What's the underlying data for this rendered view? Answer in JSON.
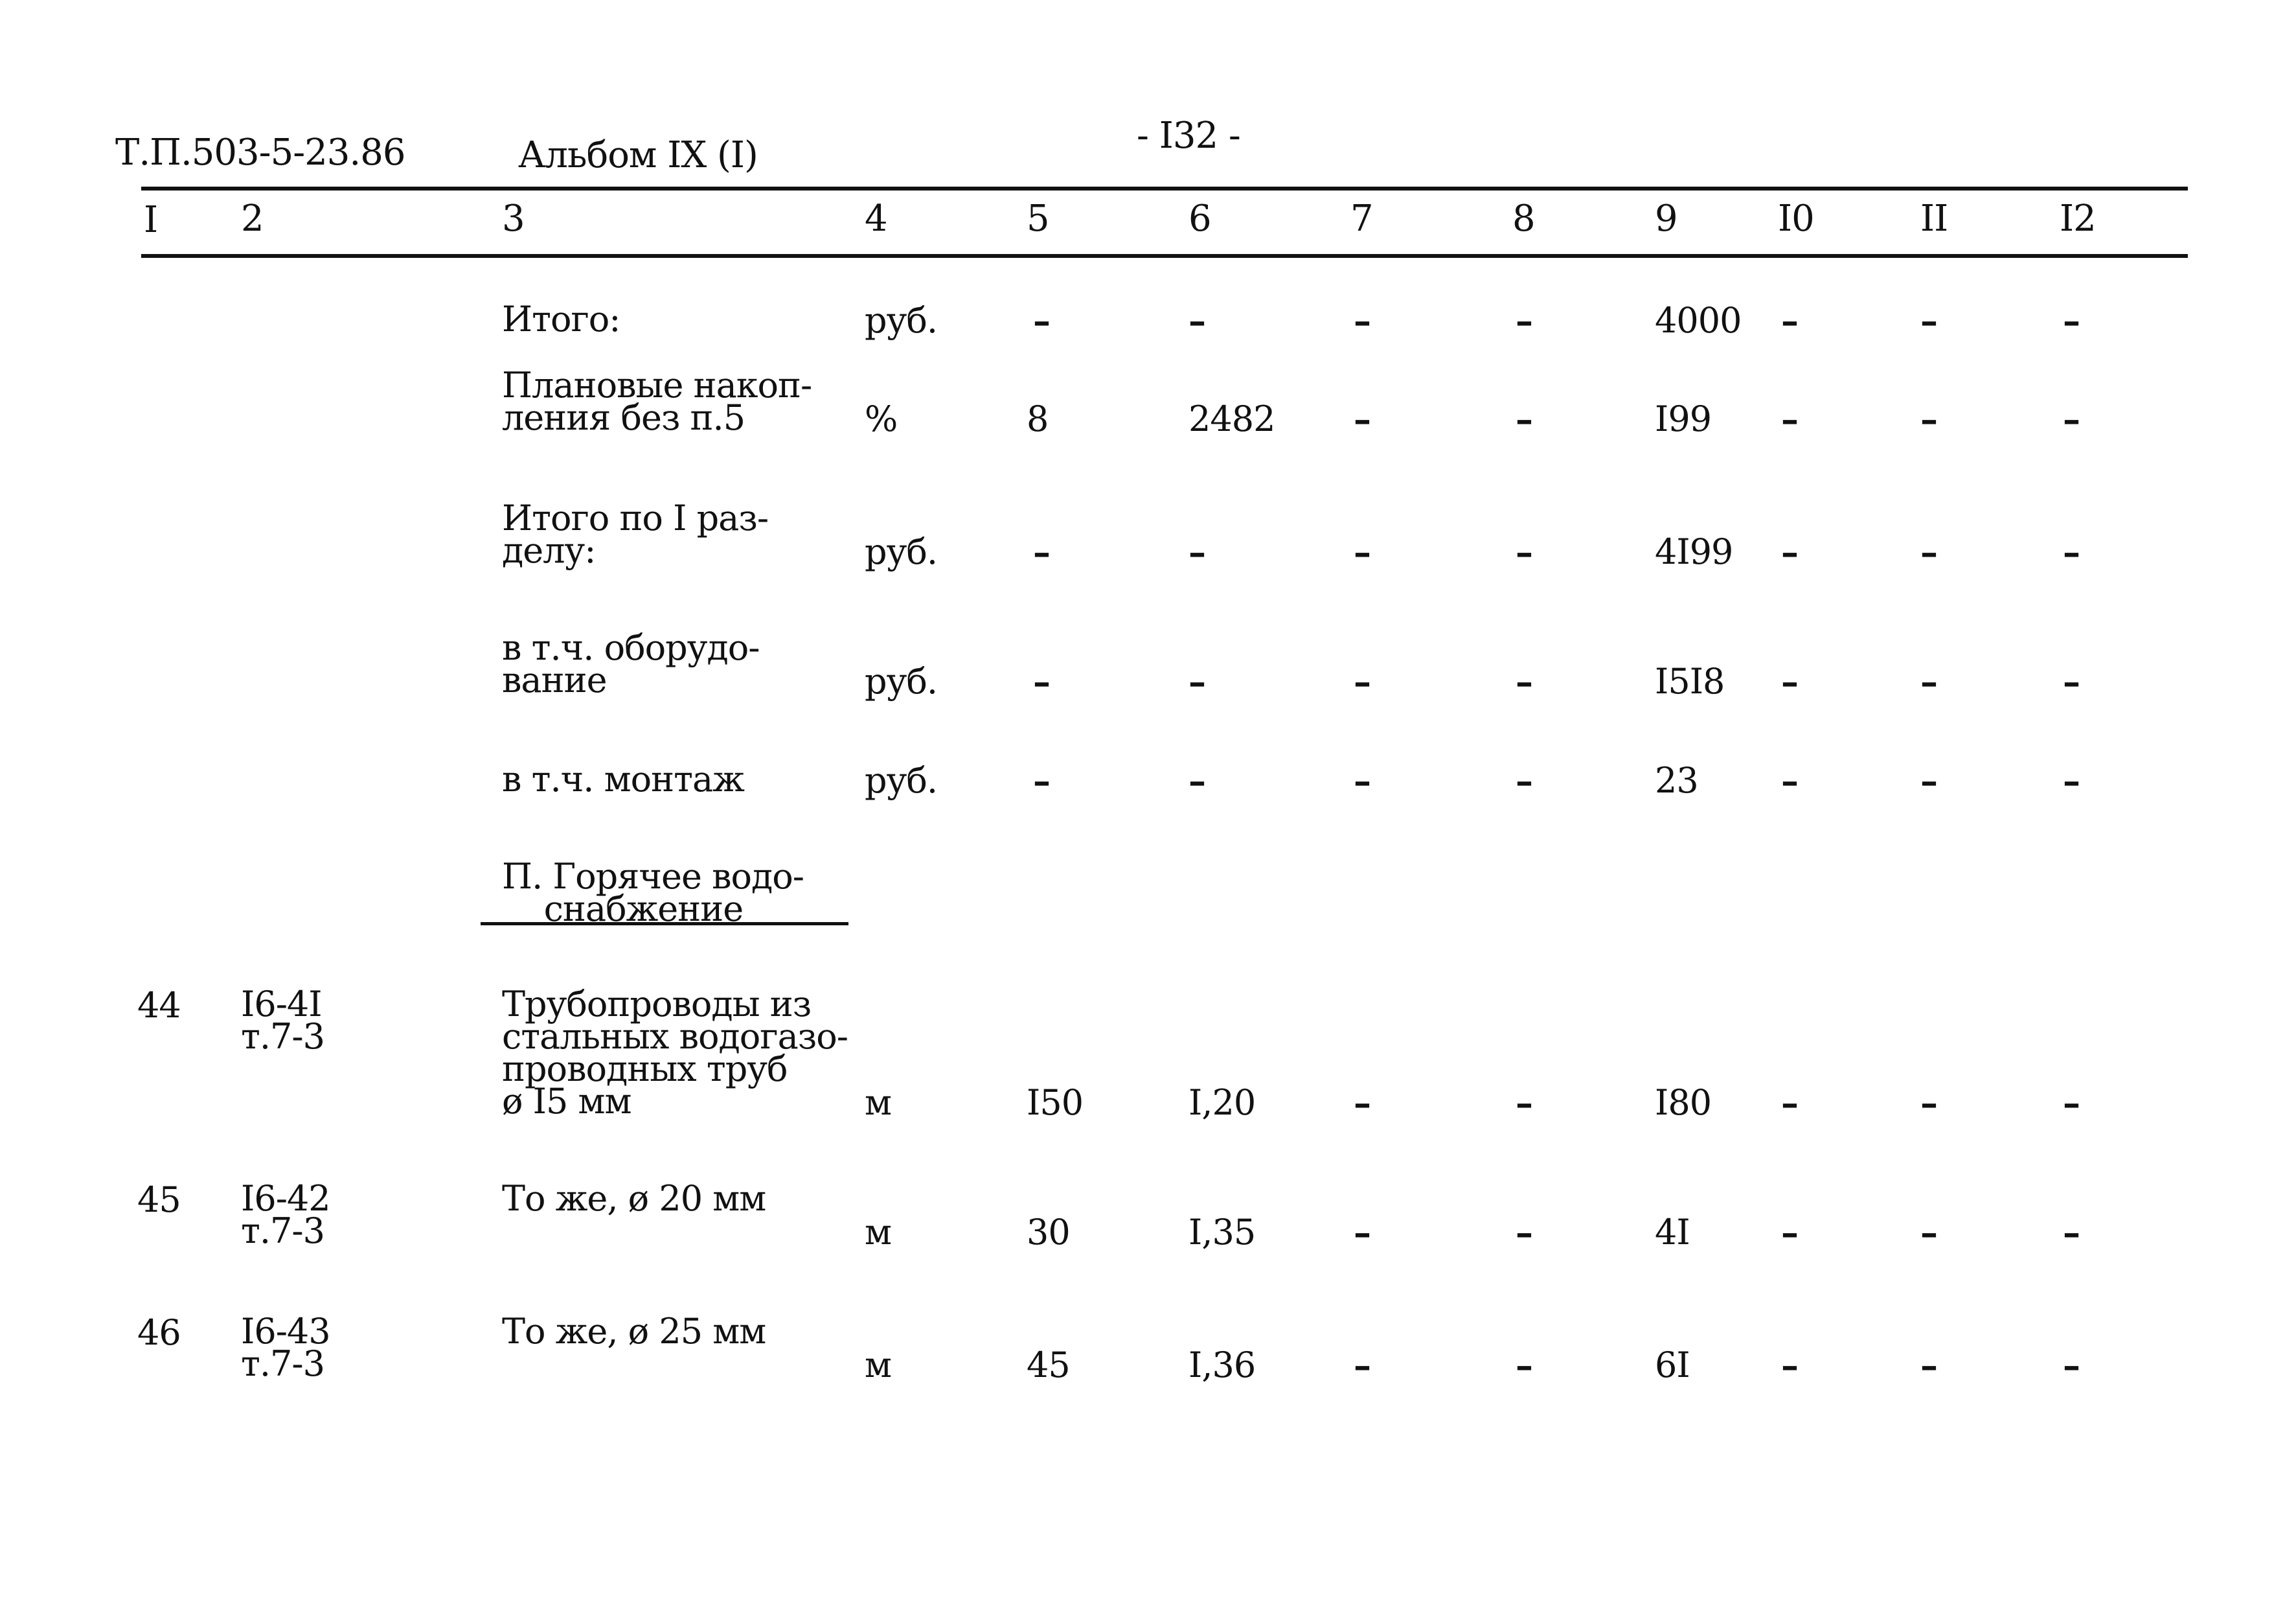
{
  "header": {
    "doc_code": "Т.П.503-5-23.86",
    "album": "Альбом IX (I)",
    "page_number": "- I32 -"
  },
  "columns": [
    "I",
    "2",
    "3",
    "4",
    "5",
    "6",
    "7",
    "8",
    "9",
    "I0",
    "II",
    "I2"
  ],
  "summary_rows": [
    {
      "name": "Итого:",
      "unit": "руб.",
      "c5": "–",
      "c6": "–",
      "c7": "–",
      "c8": "–",
      "c9": "4000",
      "c10": "–",
      "c11": "–",
      "c12": "–"
    },
    {
      "name": "Плановые накоп-\nления без п.5",
      "unit": "%",
      "c5": "8",
      "c6": "2482",
      "c7": "–",
      "c8": "–",
      "c9": "I99",
      "c10": "–",
      "c11": "–",
      "c12": "–"
    },
    {
      "name": "Итого по I раз-\nделу:",
      "unit": "руб.",
      "c5": "–",
      "c6": "–",
      "c7": "–",
      "c8": "–",
      "c9": "4I99",
      "c10": "–",
      "c11": "–",
      "c12": "–"
    },
    {
      "name": "в т.ч. оборудо-\nвание",
      "unit": "руб.",
      "c5": "–",
      "c6": "–",
      "c7": "–",
      "c8": "–",
      "c9": "I5I8",
      "c10": "–",
      "c11": "–",
      "c12": "–"
    },
    {
      "name": "в т.ч. монтаж",
      "unit": "руб.",
      "c5": "–",
      "c6": "–",
      "c7": "–",
      "c8": "–",
      "c9": "23",
      "c10": "–",
      "c11": "–",
      "c12": "–"
    }
  ],
  "section_title": "П. Горячее водо-\n    снабжение",
  "item_rows": [
    {
      "num": "44",
      "code": "I6-4I\nт.7-3",
      "name": "Трубопроводы из\nстальных водогазо-\nпроводных труб\nø I5 мм",
      "unit": "м",
      "c5": "I50",
      "c6": "I,20",
      "c7": "–",
      "c8": "–",
      "c9": "I80",
      "c10": "–",
      "c11": "–",
      "c12": "–"
    },
    {
      "num": "45",
      "code": "I6-42\nт.7-3",
      "name": "То же, ø 20 мм",
      "unit": "м",
      "c5": "30",
      "c6": "I,35",
      "c7": "–",
      "c8": "–",
      "c9": "4I",
      "c10": "–",
      "c11": "–",
      "c12": "–"
    },
    {
      "num": "46",
      "code": "I6-43\nт.7-3",
      "name": "То же, ø 25 мм",
      "unit": "м",
      "c5": "45",
      "c6": "I,36",
      "c7": "–",
      "c8": "–",
      "c9": "6I",
      "c10": "–",
      "c11": "–",
      "c12": "–"
    }
  ]
}
